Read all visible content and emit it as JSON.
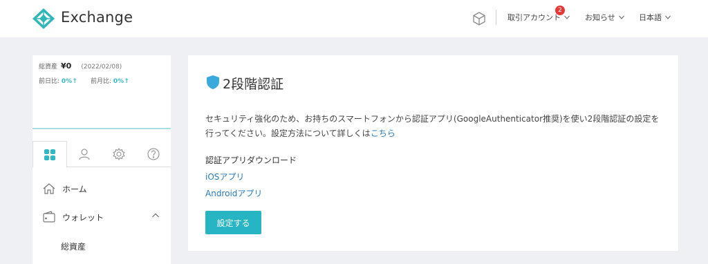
{
  "header": {
    "brand": "Exchange",
    "account_label": "取引アカウント",
    "account_badge": "2",
    "notice_label": "お知らせ",
    "lang_label": "日本語",
    "icons": [
      "exchange-logo-icon",
      "cube-icon",
      "chevron-down-icon"
    ]
  },
  "sidebar": {
    "assets_label": "総資産",
    "assets_value": "¥0",
    "assets_date": "(2022/02/08)",
    "day_change_label": "前日比:",
    "day_change_value": "0%↑",
    "month_change_label": "前月比:",
    "month_change_value": "0%↑",
    "tabs": [
      {
        "icon": "dashboard-grid-icon",
        "active": true
      },
      {
        "icon": "user-icon",
        "active": false
      },
      {
        "icon": "gear-icon",
        "active": false
      },
      {
        "icon": "help-icon",
        "active": false
      }
    ],
    "menu": {
      "home": "ホーム",
      "wallet": "ウォレット",
      "wallet_sub": "総資産"
    },
    "accent_color": "#3ab7c6"
  },
  "main": {
    "title": "2段階認証",
    "description_prefix": "セキュリティ強化のため、お持ちのスマートフォンから認証アプリ(GoogleAuthenticator推奨)を使い2段階認証の設定を行ってください。設定方法について詳しくは",
    "description_link": "こちら",
    "download_heading": "認証アプリダウンロード",
    "ios_link": "iOSアプリ",
    "android_link": "Androidアプリ",
    "setup_button": "設定する",
    "button_color": "#27b5c4",
    "link_color": "#2a7ab8"
  }
}
